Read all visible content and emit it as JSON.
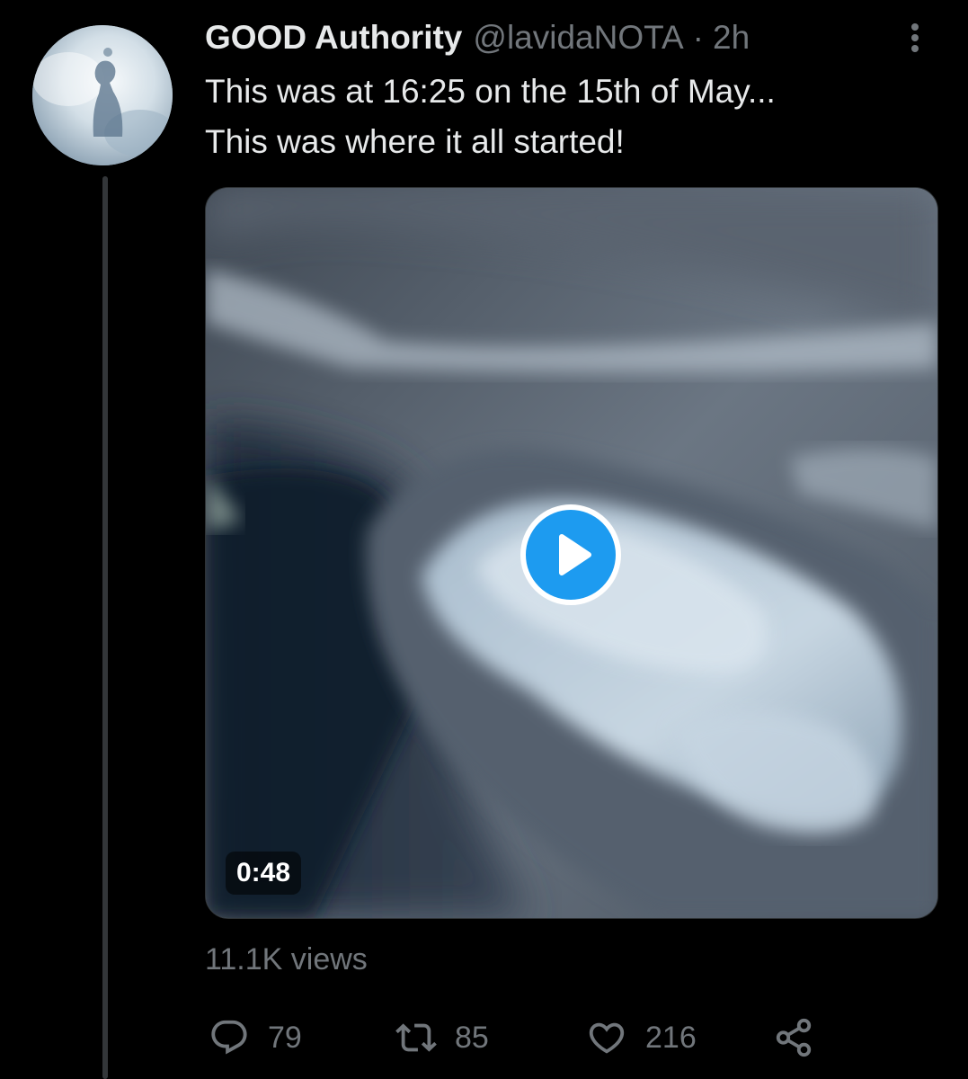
{
  "tweet": {
    "display_name": "GOOD Authority",
    "handle": "@lavidaNOTA",
    "separator": "·",
    "time": "2h",
    "text_lines": [
      "This was at 16:25 on the 15th of May...",
      "This was where it all started!"
    ],
    "video": {
      "duration": "0:48"
    },
    "views": "11.1K views",
    "actions": {
      "replies": "79",
      "retweets": "85",
      "likes": "216"
    }
  },
  "icons": {
    "more": "more-vertical-icon",
    "reply": "reply-bubble-icon",
    "retweet": "retweet-icon",
    "like": "heart-icon",
    "share": "share-icon",
    "play": "play-icon"
  },
  "colors": {
    "background": "#000000",
    "text": "#e7e9ea",
    "secondary": "#71767b",
    "accent": "#1d9bf0"
  }
}
